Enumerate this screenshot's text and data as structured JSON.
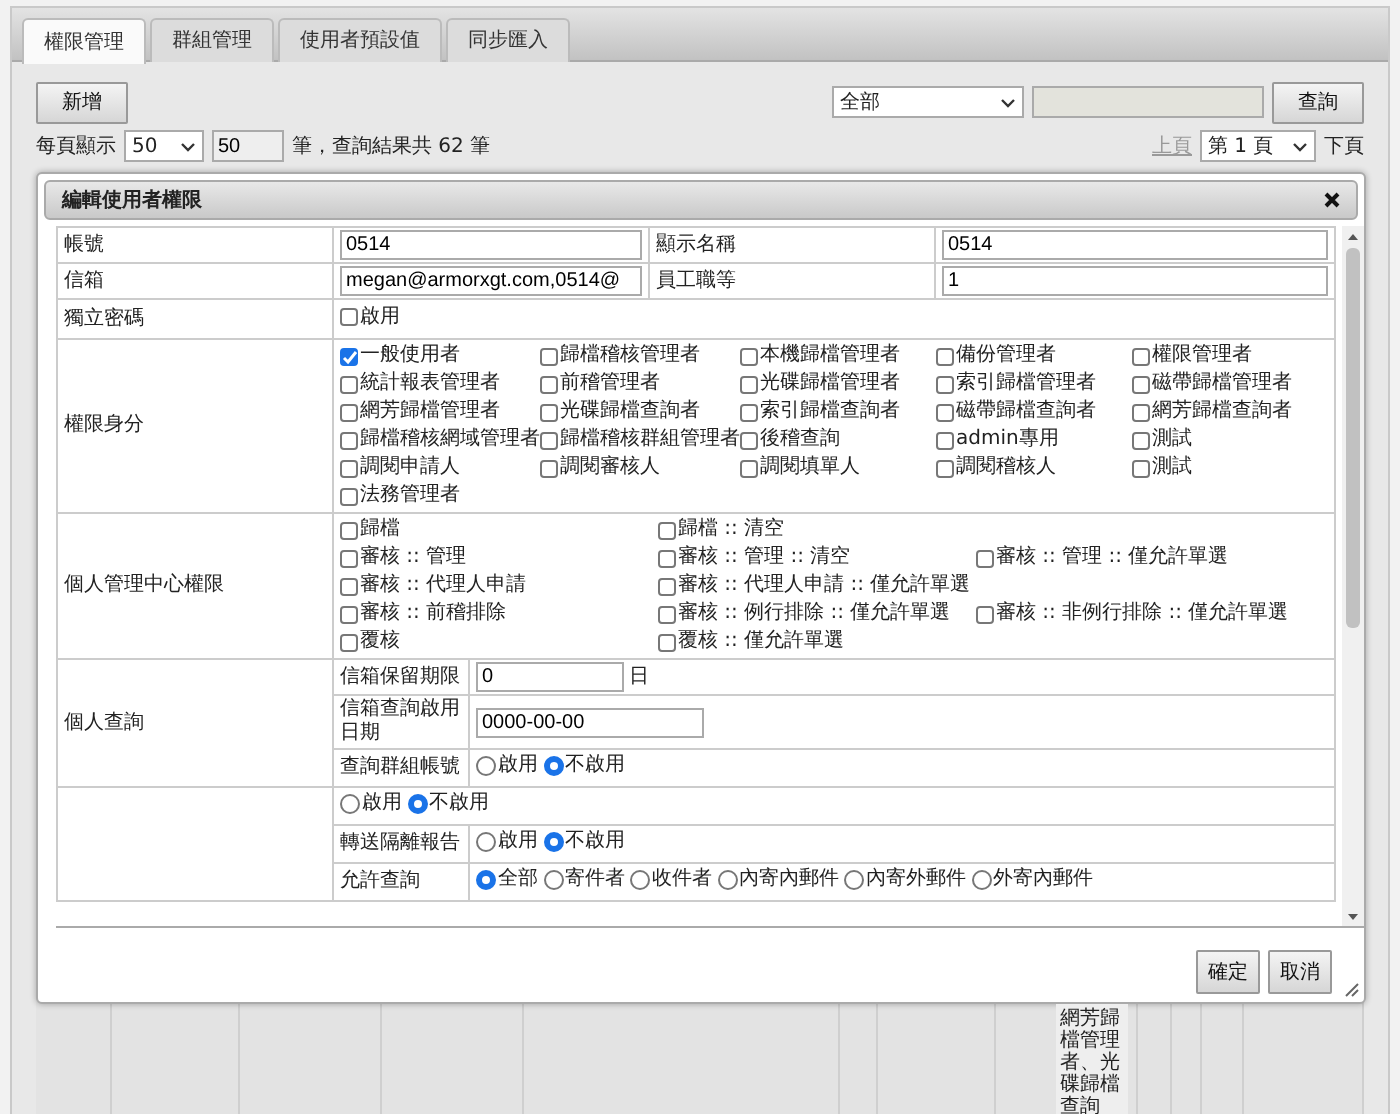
{
  "tabs": [
    {
      "label": "權限管理",
      "selected": true
    },
    {
      "label": "群組管理",
      "selected": false
    },
    {
      "label": "使用者預設值",
      "selected": false
    },
    {
      "label": "同步匯入",
      "selected": false
    }
  ],
  "toolbar": {
    "add_button": "新增",
    "filter_select": "全部",
    "search_button": "查詢"
  },
  "pagination": {
    "per_page_label": "每頁顯示",
    "per_page_select": "50",
    "per_page_field": "50",
    "result_text": "筆，查詢結果共 62 筆",
    "prev": {
      "label": "上頁",
      "disabled": true
    },
    "page_select": "第 1 頁",
    "next": {
      "label": "下頁",
      "disabled": false
    }
  },
  "dialog": {
    "title": "編輯使用者權限",
    "account": {
      "label": "帳號",
      "value": "0514"
    },
    "display_name": {
      "label": "顯示名稱",
      "value": "0514"
    },
    "email": {
      "label": "信箱",
      "value": "megan@armorxgt.com,0514@"
    },
    "rank": {
      "label": "員工職等",
      "value": "1"
    },
    "independent_password": {
      "label": "獨立密碼",
      "option": {
        "label": "啟用",
        "checked": false
      }
    },
    "roles": {
      "label": "權限身分",
      "options": [
        {
          "label": "一般使用者",
          "checked": true
        },
        {
          "label": "歸檔稽核管理者",
          "checked": false
        },
        {
          "label": "本機歸檔管理者",
          "checked": false
        },
        {
          "label": "備份管理者",
          "checked": false
        },
        {
          "label": "權限管理者",
          "checked": false
        },
        {
          "label": "統計報表管理者",
          "checked": false
        },
        {
          "label": "前稽管理者",
          "checked": false
        },
        {
          "label": "光碟歸檔管理者",
          "checked": false
        },
        {
          "label": "索引歸檔管理者",
          "checked": false
        },
        {
          "label": "磁帶歸檔管理者",
          "checked": false
        },
        {
          "label": "網芳歸檔管理者",
          "checked": false
        },
        {
          "label": "光碟歸檔查詢者",
          "checked": false
        },
        {
          "label": "索引歸檔查詢者",
          "checked": false
        },
        {
          "label": "磁帶歸檔查詢者",
          "checked": false
        },
        {
          "label": "網芳歸檔查詢者",
          "checked": false
        },
        {
          "label": "歸檔稽核網域管理者",
          "checked": false
        },
        {
          "label": "歸檔稽核群組管理者",
          "checked": false
        },
        {
          "label": "後稽查詢",
          "checked": false
        },
        {
          "label": "admin專用",
          "checked": false
        },
        {
          "label": "測試",
          "checked": false
        },
        {
          "label": "調閱申請人",
          "checked": false
        },
        {
          "label": "調閱審核人",
          "checked": false
        },
        {
          "label": "調閱填單人",
          "checked": false
        },
        {
          "label": "調閱稽核人",
          "checked": false
        },
        {
          "label": "測試",
          "checked": false
        },
        {
          "label": "法務管理者",
          "checked": false
        }
      ]
    },
    "personal_center": {
      "label": "個人管理中心權限",
      "option_lines": [
        [
          {
            "label": "歸檔",
            "checked": false
          },
          {
            "label": "歸檔 :: 清空",
            "checked": false
          }
        ],
        [
          {
            "label": "審核 :: 管理",
            "checked": false
          },
          {
            "label": "審核 :: 管理 :: 清空",
            "checked": false
          },
          {
            "label": "審核 :: 管理 :: 僅允許單選",
            "checked": false
          }
        ],
        [
          {
            "label": "審核 :: 代理人申請",
            "checked": false
          },
          {
            "label": "審核 :: 代理人申請 :: 僅允許單選",
            "checked": false
          }
        ],
        [
          {
            "label": "審核 :: 前稽排除",
            "checked": false
          },
          {
            "label": "審核 :: 例行排除 :: 僅允許單選",
            "checked": false
          },
          {
            "label": "審核 :: 非例行排除 :: 僅允許單選",
            "checked": false
          }
        ],
        [
          {
            "label": "覆核",
            "checked": false
          },
          {
            "label": "覆核 :: 僅允許單選",
            "checked": false
          }
        ]
      ]
    },
    "personal_query": {
      "label": "個人查詢",
      "rows": [
        {
          "kind": "text",
          "label": "信箱保留期限",
          "value": "0",
          "suffix": "日"
        },
        {
          "kind": "date",
          "label": "信箱查詢啟用日期",
          "value": "0000-00-00"
        },
        {
          "kind": "radio",
          "label": "查詢群組帳號",
          "options": [
            {
              "label": "啟用",
              "selected": false
            },
            {
              "label": "不啟用",
              "selected": true
            }
          ]
        }
      ]
    },
    "forward": {
      "rows": [
        {
          "kind": "radio",
          "options": [
            {
              "label": "啟用",
              "selected": false
            },
            {
              "label": "不啟用",
              "selected": true
            }
          ]
        },
        {
          "kind": "radio",
          "label": "轉送隔離報告",
          "options": [
            {
              "label": "啟用",
              "selected": false
            },
            {
              "label": "不啟用",
              "selected": true
            }
          ]
        },
        {
          "kind": "radio",
          "label": "允許查詢",
          "options": [
            {
              "label": "全部",
              "selected": true
            },
            {
              "label": "寄件者",
              "selected": false
            },
            {
              "label": "收件者",
              "selected": false
            },
            {
              "label": "內寄內郵件",
              "selected": false
            },
            {
              "label": "內寄外郵件",
              "selected": false
            },
            {
              "label": "外寄內郵件",
              "selected": false
            }
          ]
        }
      ]
    },
    "buttons": [
      {
        "label": "確定"
      },
      {
        "label": "取消"
      }
    ]
  },
  "background_cell": "網芳歸檔管理者、光碟歸檔查詢"
}
